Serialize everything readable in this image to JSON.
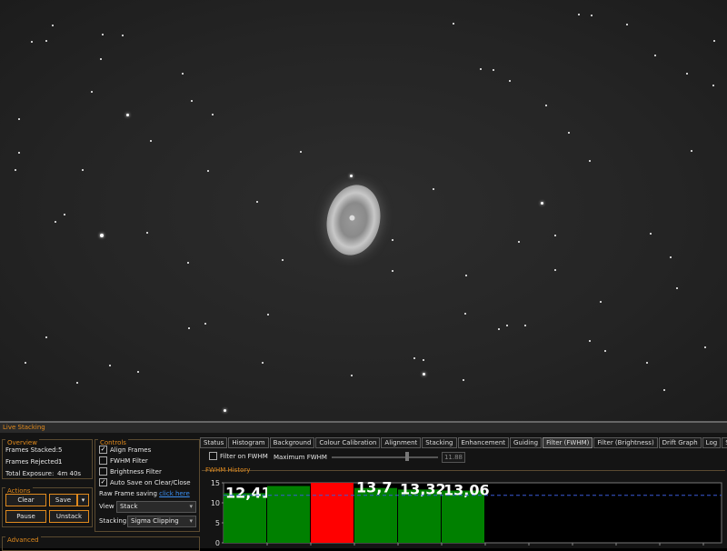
{
  "panel_title": "Live Stacking",
  "overview": {
    "title": "Overview",
    "frames_stacked_label": "Frames Stacked:",
    "frames_stacked_value": "5",
    "frames_rejected_label": "Frames Rejected:",
    "frames_rejected_value": "1",
    "total_exposure_label": "Total Exposure:",
    "total_exposure_value": "4m 40s"
  },
  "actions": {
    "title": "Actions",
    "clear": "Clear",
    "save": "Save",
    "pause": "Pause",
    "unstack": "Unstack"
  },
  "advanced": {
    "title": "Advanced"
  },
  "controls": {
    "title": "Controls",
    "align_frames": {
      "label": "Align Frames",
      "checked": true
    },
    "fwhm_filter": {
      "label": "FWHM Filter",
      "checked": false
    },
    "brightness_filter": {
      "label": "Brightness Filter",
      "checked": false
    },
    "auto_save": {
      "label": "Auto Save on Clear/Close",
      "checked": true
    },
    "raw_frame_label": "Raw Frame saving",
    "raw_frame_link": "click here",
    "view_label": "View",
    "view_value": "Stack",
    "stacking_label": "Stacking",
    "stacking_value": "Sigma Clipping"
  },
  "tabs": [
    "Status",
    "Histogram",
    "Background",
    "Colour Calibration",
    "Alignment",
    "Stacking",
    "Enhancement",
    "Guiding",
    "Filter (FWHM)",
    "Filter (Brightness)",
    "Drift Graph",
    "Log",
    "Settings"
  ],
  "active_tab": "Filter (FWHM)",
  "fwhm_filter": {
    "filter_label": "Filter on FWHM",
    "max_label": "Maximum FWHM",
    "max_value": "11.88"
  },
  "history_title": "FWHM History",
  "chart_data": {
    "type": "bar",
    "values": [
      12.41,
      14.2,
      16.5,
      13.7,
      13.32,
      13.06
    ],
    "colors": [
      "#008000",
      "#008000",
      "#ff0000",
      "#008000",
      "#008000",
      "#008000"
    ],
    "labels": [
      "12,41",
      "",
      "",
      "13,7",
      "13,32",
      "13,06"
    ],
    "ylim": [
      0,
      15
    ],
    "yticks": [
      "0",
      "5",
      "10",
      "15"
    ],
    "threshold": 11.88,
    "threshold_color": "#3a5ad8"
  }
}
